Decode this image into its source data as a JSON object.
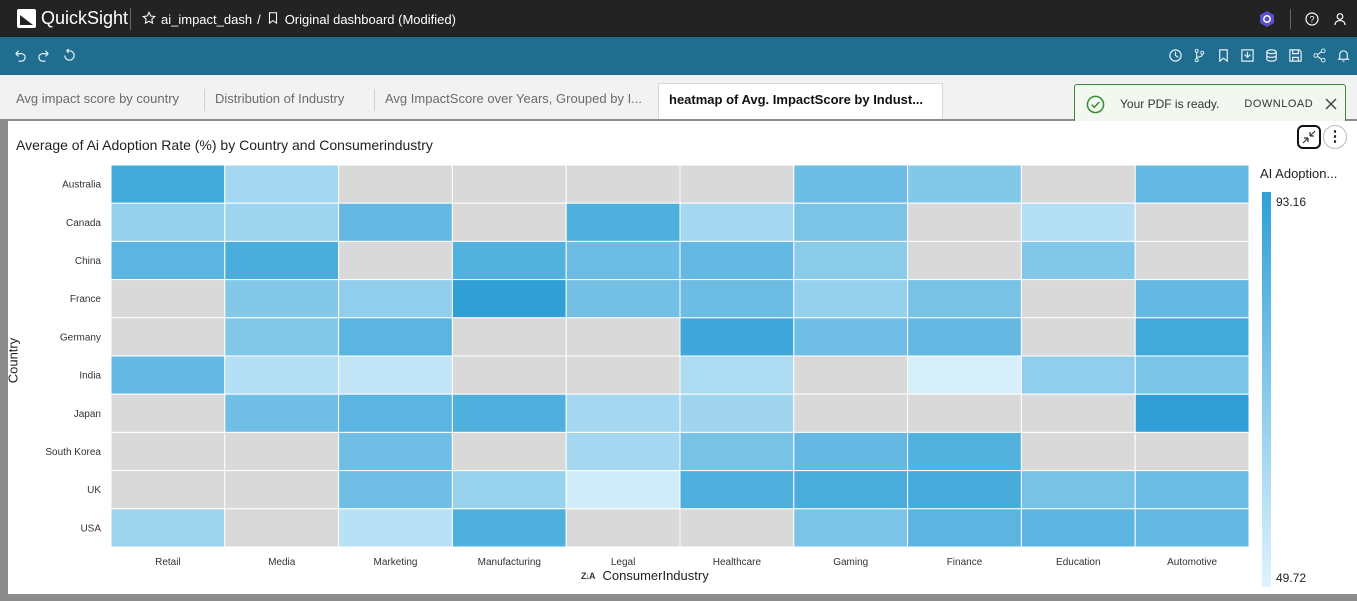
{
  "app": {
    "name": "QuickSight"
  },
  "breadcrumb": {
    "analysis": "ai_impact_dash",
    "separator": "/",
    "dashboard": "Original dashboard (Modified)"
  },
  "tabs": [
    {
      "label": "Avg impact score by country"
    },
    {
      "label": "Distribution of Industry"
    },
    {
      "label": "Avg ImpactScore over Years, Grouped by I..."
    },
    {
      "label": "heatmap of Avg. ImpactScore by Indust..."
    }
  ],
  "toast": {
    "message": "Your PDF is ready.",
    "action": "DOWNLOAD"
  },
  "colors": {
    "topbar": "#232323",
    "toolbar": "#1f6d8f",
    "accent": "#2e9fd6",
    "empty_cell": "#d9d9d9",
    "success": "#3a8b35"
  },
  "chart_data": {
    "type": "heatmap",
    "title": "Average of Ai Adoption Rate (%) by Country and Consumerindustry",
    "xlabel": "ConsumerIndustry",
    "ylabel": "Country",
    "x_categories": [
      "Retail",
      "Media",
      "Marketing",
      "Manufacturing",
      "Legal",
      "Healthcare",
      "Gaming",
      "Finance",
      "Education",
      "Automotive"
    ],
    "y_categories": [
      "Australia",
      "Canada",
      "China",
      "France",
      "Germany",
      "India",
      "Japan",
      "South Korea",
      "UK",
      "USA"
    ],
    "values": [
      [
        88,
        64,
        null,
        null,
        null,
        null,
        78,
        72,
        null,
        80
      ],
      [
        68,
        66,
        80,
        null,
        85,
        64,
        74,
        null,
        60,
        null
      ],
      [
        82,
        86,
        null,
        84,
        78,
        80,
        70,
        null,
        72,
        null
      ],
      [
        null,
        72,
        69,
        93,
        76,
        78,
        68,
        75,
        null,
        80
      ],
      [
        null,
        72,
        82,
        null,
        null,
        89,
        77,
        80,
        null,
        88
      ],
      [
        80,
        60,
        57,
        null,
        null,
        62,
        null,
        52,
        69,
        74
      ],
      [
        null,
        77,
        82,
        85,
        64,
        65,
        null,
        null,
        null,
        93
      ],
      [
        null,
        null,
        77,
        null,
        64,
        75,
        80,
        84,
        null,
        null
      ],
      [
        null,
        null,
        77,
        67,
        53,
        85,
        86,
        87,
        75,
        78
      ],
      [
        66,
        null,
        59,
        85,
        null,
        null,
        74,
        82,
        82,
        80
      ]
    ],
    "legend": {
      "title": "AI Adoption...",
      "max": "93.16",
      "min": "49.72",
      "placement": "right"
    }
  }
}
